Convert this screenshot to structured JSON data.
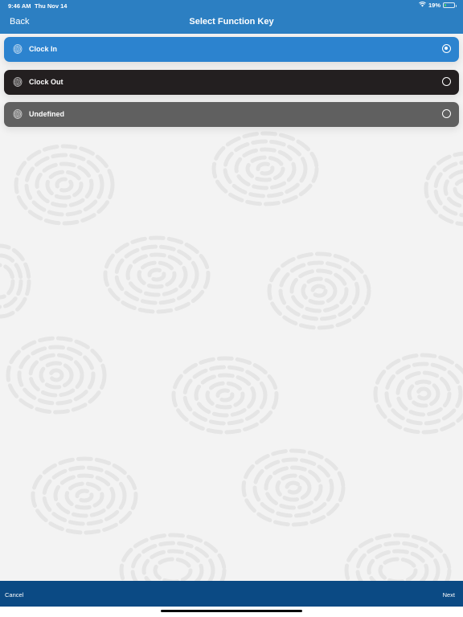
{
  "status_bar": {
    "time": "9:46 AM",
    "date": "Thu Nov 14",
    "battery_text": "19%",
    "battery_level": 0.19,
    "wifi_icon": "wifi-icon",
    "battery_icon": "battery-icon"
  },
  "nav": {
    "back_label": "Back",
    "title": "Select Function Key"
  },
  "options": [
    {
      "label": "Clock In",
      "selected": true,
      "color": "#2c83cf",
      "icon": "fingerprint-icon"
    },
    {
      "label": "Clock Out",
      "selected": false,
      "color": "#231f20",
      "icon": "fingerprint-icon"
    },
    {
      "label": "Undefined",
      "selected": false,
      "color": "#606060",
      "icon": "fingerprint-icon"
    }
  ],
  "footer": {
    "cancel_label": "Cancel",
    "next_label": "Next"
  },
  "colors": {
    "header": "#2c7fc2",
    "footer": "#0b4a84",
    "background": "#f3f3f3"
  }
}
